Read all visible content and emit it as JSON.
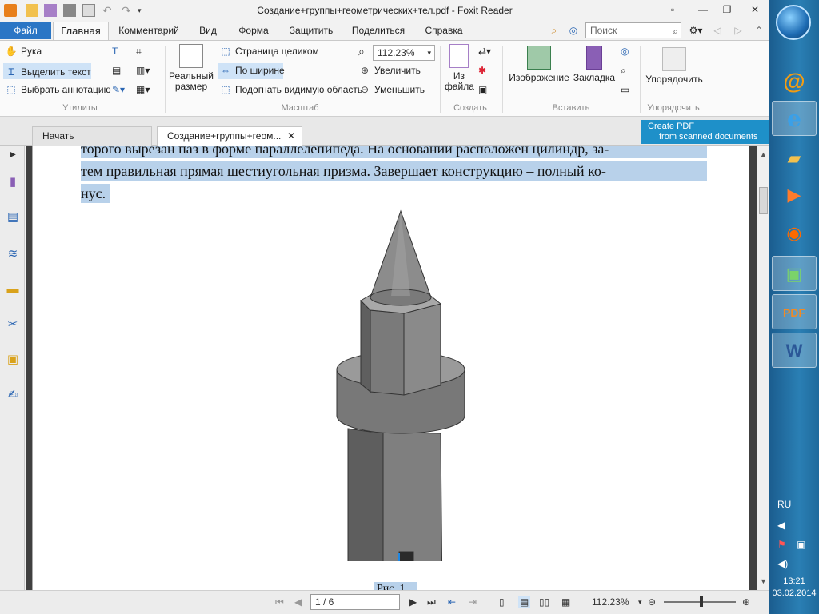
{
  "window": {
    "title": "Создание+группы+геометрических+тел.pdf - Foxit Reader"
  },
  "ribbon_tabs": [
    {
      "label": "Файл"
    },
    {
      "label": "Главная"
    },
    {
      "label": "Комментарий"
    },
    {
      "label": "Вид"
    },
    {
      "label": "Форма"
    },
    {
      "label": "Защитить"
    },
    {
      "label": "Поделиться"
    },
    {
      "label": "Справка"
    }
  ],
  "search": {
    "placeholder": "Поиск"
  },
  "ribbon": {
    "utilities": {
      "hand": "Рука",
      "select_text": "Выделить текст",
      "select_annotation": "Выбрать аннотацию",
      "group_label": "Утилиты"
    },
    "scale": {
      "actual_size": "Реальный размер",
      "full_page": "Страница целиком",
      "fit_width": "По ширине",
      "fit_visible": "Подогнать видимую область",
      "zoom_value": "112.23%",
      "zoom_in": "Увеличить",
      "zoom_out": "Уменьшить",
      "group_label": "Масштаб"
    },
    "create": {
      "from_file": "Из файла",
      "group_label": "Создать"
    },
    "insert": {
      "image": "Изображение",
      "bookmark": "Закладка",
      "group_label": "Вставить"
    },
    "arrange": {
      "arrange": "Упорядочить",
      "group_label": "Упорядочить"
    }
  },
  "doc_tabs": [
    {
      "label": "Начать"
    },
    {
      "label": "Создание+группы+геом..."
    }
  ],
  "ad": {
    "line1": "Create PDF",
    "line2": "from scanned documents"
  },
  "document": {
    "lines": [
      "торого вырезан паз в форме параллелепипеда. На основании расположен цилиндр, за-",
      "тем правильная прямая шестиугольная призма. Завершает конструкцию – полный ко-",
      "нус."
    ],
    "caption": "Рис. 1"
  },
  "statusbar": {
    "page_display": "1 / 6",
    "zoom": "112.23%"
  },
  "taskbar": {
    "language": "RU",
    "time": "13:21",
    "date": "03.02.2014"
  },
  "colors": {
    "accent": "#2b76c5",
    "selection": "#b8d1ea",
    "taskbar": "#2a7fb4"
  }
}
